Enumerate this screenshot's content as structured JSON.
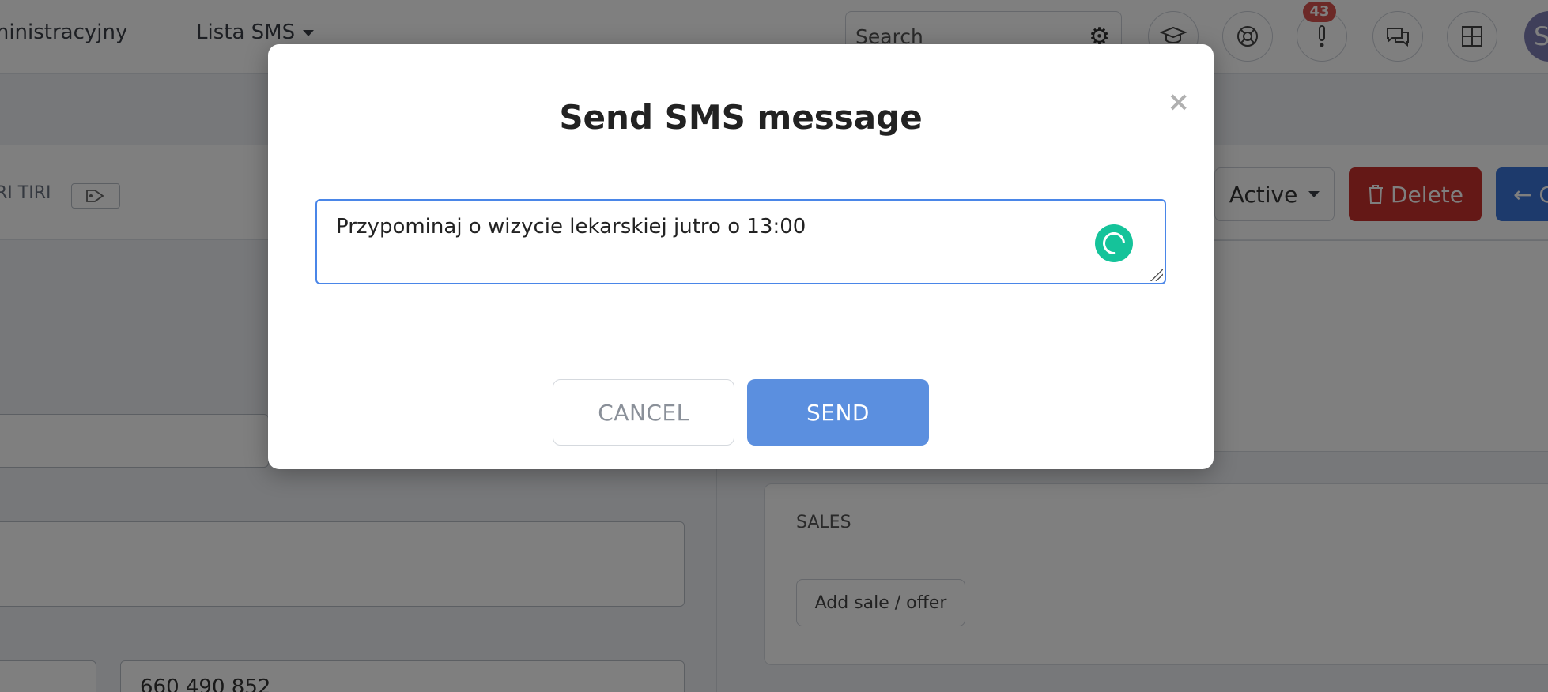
{
  "header": {
    "nav_admin": "ministracyjny",
    "nav_sms": "Lista SMS",
    "search_placeholder": "Search",
    "notification_count": "43",
    "avatar_letter": "S"
  },
  "toolbar": {
    "tag_text": "RI TIRI",
    "status_label": "Active",
    "delete_label": "Delete",
    "back_label": "C"
  },
  "form": {
    "phone_value": "660 490 852"
  },
  "sales": {
    "title": "SALES",
    "add_button": "Add sale / offer"
  },
  "modal": {
    "title": "Send SMS message",
    "close_symbol": "×",
    "message_value": "Przypominaj o wizycie lekarskiej jutro o 13:00",
    "cancel_label": "CANCEL",
    "send_label": "SEND"
  },
  "icons": {
    "gear": "gear-icon",
    "graduation": "graduation-cap-icon",
    "lifebuoy": "lifebuoy-icon",
    "alert": "exclamation-icon",
    "chat": "chat-bubbles-icon",
    "grid": "grid-icon",
    "tag": "tag-icon",
    "trash": "trash-icon",
    "arrow": "arrow-left-icon",
    "grammar": "grammar-check-icon"
  },
  "colors": {
    "accent_blue": "#5b8fdf",
    "focus_border": "#4a86e8",
    "danger": "#c9302c",
    "badge": "#d9534f",
    "grammar_green": "#15c39a"
  }
}
